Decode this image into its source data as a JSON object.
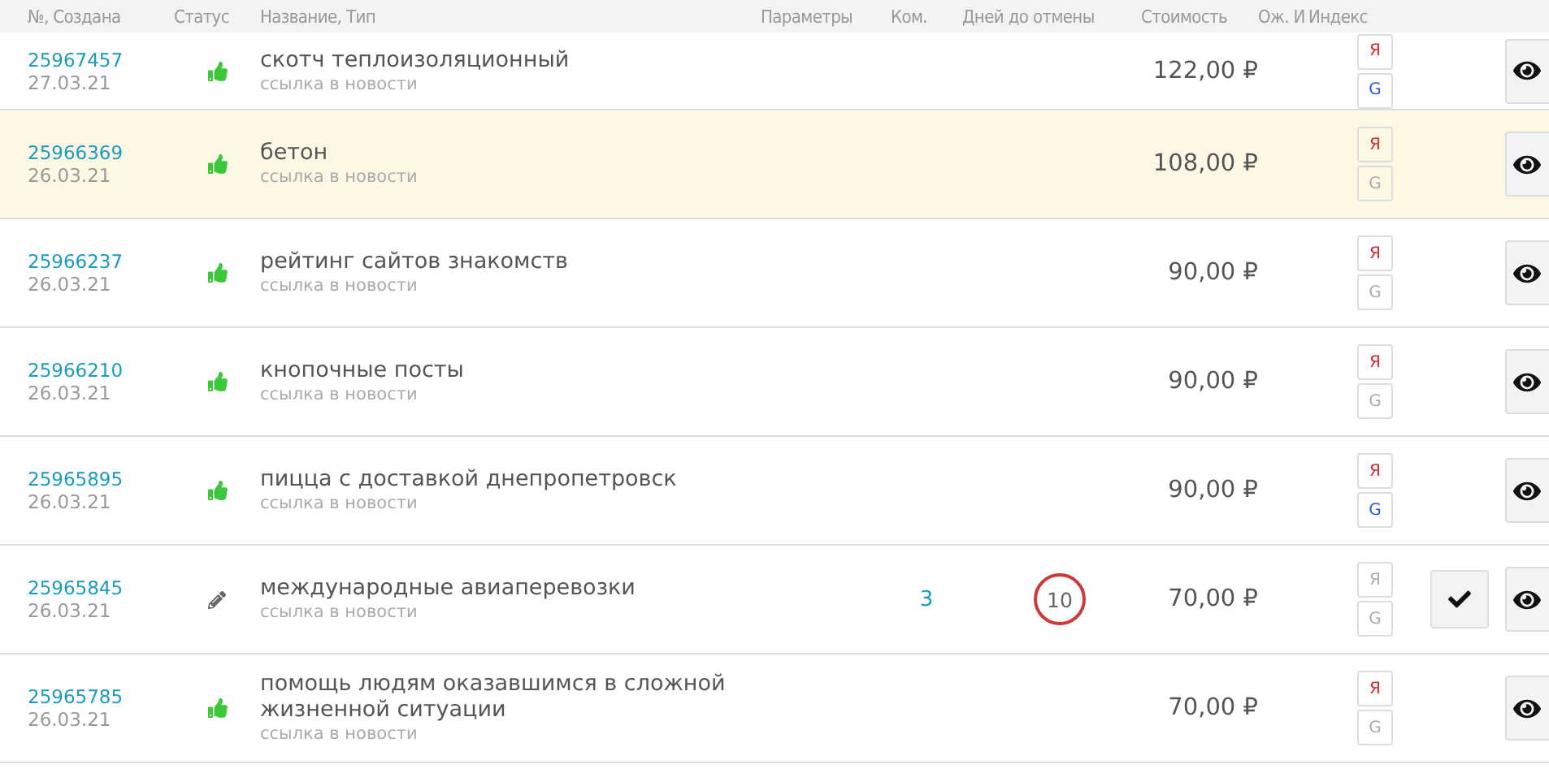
{
  "columns": [
    "№, Создана",
    "Статус",
    "Название, Тип",
    "Параметры",
    "Ком.",
    "Дней до отмены",
    "Стоимость",
    "Ож. И",
    "Индекс"
  ],
  "rows": [
    {
      "id": "25967457",
      "date": "27.03.21",
      "kind": "approved",
      "name": "скотч теплоизоляционный",
      "type": "ссылка в новости",
      "price": "122,00 ₽",
      "highlighted": false,
      "yandex": "Я",
      "yandex_indexed": true,
      "google": "G",
      "google_indexed": true
    },
    {
      "id": "25966369",
      "date": "26.03.21",
      "kind": "approved",
      "name": "бетон",
      "type": "ссылка в новости",
      "price": "108,00 ₽",
      "highlighted": true,
      "yandex": "Я",
      "yandex_indexed": true,
      "google": "G",
      "google_indexed": false
    },
    {
      "id": "25966237",
      "date": "26.03.21",
      "kind": "approved",
      "name": "рейтинг сайтов знакомств",
      "type": "ссылка в новости",
      "price": "90,00 ₽",
      "highlighted": false,
      "yandex": "Я",
      "yandex_indexed": true,
      "google": "G",
      "google_indexed": false
    },
    {
      "id": "25966210",
      "date": "26.03.21",
      "kind": "approved",
      "name": "кнопочные посты",
      "type": "ссылка в новости",
      "price": "90,00 ₽",
      "highlighted": false,
      "yandex": "Я",
      "yandex_indexed": true,
      "google": "G",
      "google_indexed": false
    },
    {
      "id": "25965895",
      "date": "26.03.21",
      "kind": "approved",
      "name": "пицца с доставкой днепропетровск",
      "type": "ссылка в новости",
      "price": "90,00 ₽",
      "highlighted": false,
      "yandex": "Я",
      "yandex_indexed": true,
      "google": "G",
      "google_indexed": true
    },
    {
      "id": "25965845",
      "date": "26.03.21",
      "kind": "draft",
      "name": "международные авиаперевозки",
      "type": "ссылка в новости",
      "comments": "3",
      "days": "10",
      "price": "70,00 ₽",
      "highlighted": false,
      "yandex": "Я",
      "yandex_indexed": false,
      "google": "G",
      "google_indexed": false,
      "approve_button": true
    },
    {
      "id": "25965785",
      "date": "26.03.21",
      "kind": "approved",
      "name": "помощь людям оказавшимся в сложной жизненной ситуации",
      "type": "ссылка в новости",
      "price": "70,00 ₽",
      "highlighted": false,
      "yandex": "Я",
      "yandex_indexed": true,
      "google": "G",
      "google_indexed": false
    }
  ]
}
